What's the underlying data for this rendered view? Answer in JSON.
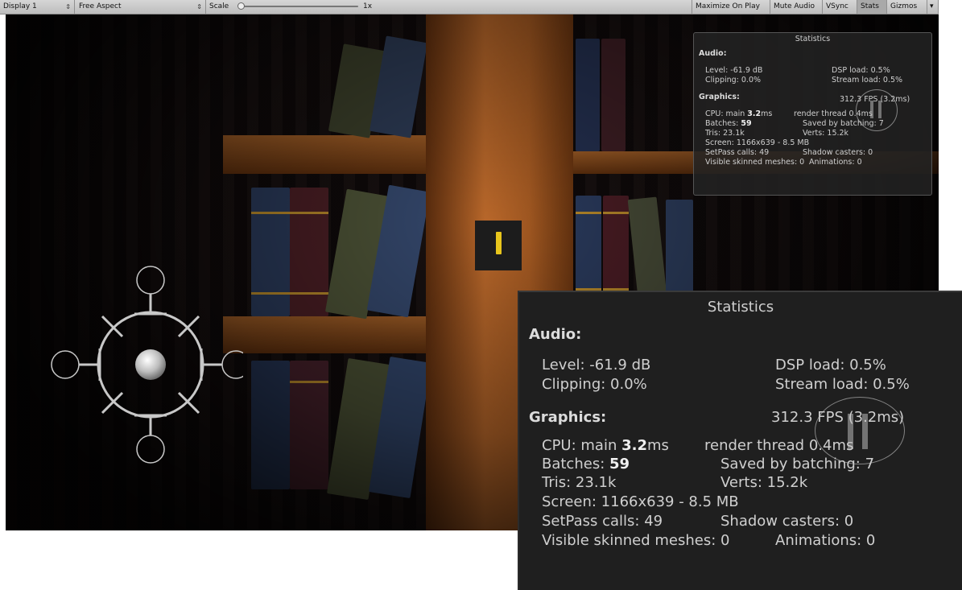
{
  "toolbar": {
    "display": "Display 1",
    "aspect": "Free Aspect",
    "scale_label": "Scale",
    "scale_value": "1x",
    "scale_level": 0.0,
    "maximize": "Maximize On Play",
    "mute": "Mute Audio",
    "vsync": "VSync",
    "stats": "Stats",
    "gizmos": "Gizmos"
  },
  "stats": {
    "title": "Statistics",
    "audio_header": "Audio:",
    "level": "Level: -61.9 dB",
    "dsp": "DSP load: 0.5%",
    "clipping": "Clipping: 0.0%",
    "stream": "Stream load: 0.5%",
    "graphics_header": "Graphics:",
    "fps": "312.3 FPS (3.2ms)",
    "cpu_prefix": "CPU: main ",
    "cpu_main": "3.2",
    "cpu_suffix": "ms",
    "render_thread": "render thread 0.4ms",
    "batches_prefix": "Batches: ",
    "batches": "59",
    "saved": "Saved by batching: 7",
    "tris": "Tris: 23.1k",
    "verts": "Verts: 15.2k",
    "screen": "Screen: 1166x639 - 8.5 MB",
    "setpass": "SetPass calls: 49",
    "shadow": "Shadow casters: 0",
    "skinned": "Visible skinned meshes: 0",
    "animations": "Animations: 0"
  },
  "colors": {
    "marker_accent": "#e8c51c",
    "wood": "#a55a22",
    "panel_bg": "#1f1f1f"
  }
}
